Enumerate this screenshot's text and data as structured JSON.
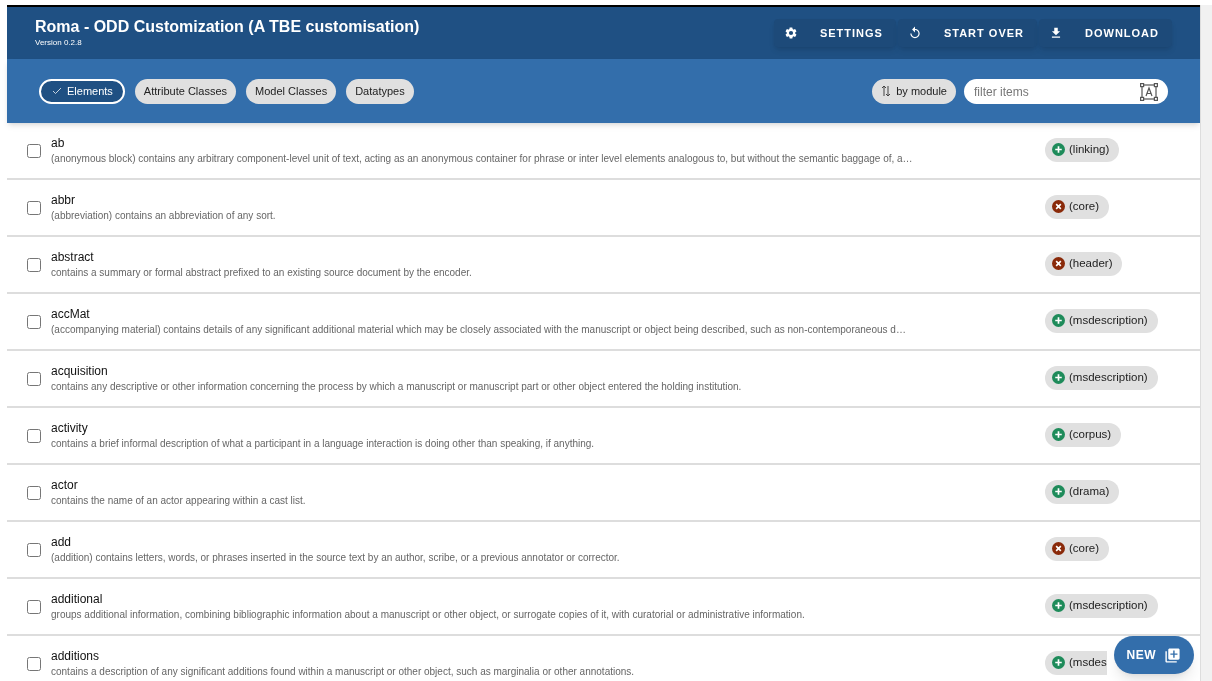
{
  "header": {
    "title": "Roma - ODD Customization (A TBE customisation)",
    "version": "Version 0.2.8",
    "actions": [
      {
        "kind": "settings",
        "label": "SETTINGS"
      },
      {
        "kind": "restart",
        "label": "START OVER"
      },
      {
        "kind": "download",
        "label": "DOWNLOAD"
      }
    ]
  },
  "filters": [
    {
      "label": "Elements",
      "selected": true
    },
    {
      "label": "Attribute Classes",
      "selected": false
    },
    {
      "label": "Model Classes",
      "selected": false
    },
    {
      "label": "Datatypes",
      "selected": false
    }
  ],
  "sort": {
    "label": "by module"
  },
  "search": {
    "placeholder": "filter items"
  },
  "items": [
    {
      "name": "ab",
      "description": "(anonymous block) contains any arbitrary component-level unit of text, acting as an anonymous container for phrase or inter level elements analogous to, but without the semantic baggage of, a…",
      "checked": false,
      "module": "(linking)",
      "included": true
    },
    {
      "name": "abbr",
      "description": "(abbreviation) contains an abbreviation of any sort.",
      "checked": false,
      "module": "(core)",
      "included": false
    },
    {
      "name": "abstract",
      "description": "contains a summary or formal abstract prefixed to an existing source document by the encoder.",
      "checked": false,
      "module": "(header)",
      "included": false
    },
    {
      "name": "accMat",
      "description": "(accompanying material) contains details of any significant additional material which may be closely associated with the manuscript or object being described, such as non-contemporaneous d…",
      "checked": false,
      "module": "(msdescription)",
      "included": true
    },
    {
      "name": "acquisition",
      "description": "contains any descriptive or other information concerning the process by which a manuscript or manuscript part or other object entered the holding institution.",
      "checked": false,
      "module": "(msdescription)",
      "included": true
    },
    {
      "name": "activity",
      "description": "contains a brief informal description of what a participant in a language interaction is doing other than speaking, if anything.",
      "checked": false,
      "module": "(corpus)",
      "included": true
    },
    {
      "name": "actor",
      "description": "contains the name of an actor appearing within a cast list.",
      "checked": false,
      "module": "(drama)",
      "included": true
    },
    {
      "name": "add",
      "description": "(addition) contains letters, words, or phrases inserted in the source text by an author, scribe, or a previous annotator or corrector.",
      "checked": false,
      "module": "(core)",
      "included": false
    },
    {
      "name": "additional",
      "description": "groups additional information, combining bibliographic information about a manuscript or other object, or surrogate copies of it, with curatorial or administrative information.",
      "checked": false,
      "module": "(msdescription)",
      "included": true
    },
    {
      "name": "additions",
      "description": "contains a description of any significant additions found within a manuscript or other object, such as marginalia or other annotations.",
      "checked": false,
      "module": "(msdes",
      "included": true
    }
  ],
  "fab": {
    "label": "NEW"
  }
}
